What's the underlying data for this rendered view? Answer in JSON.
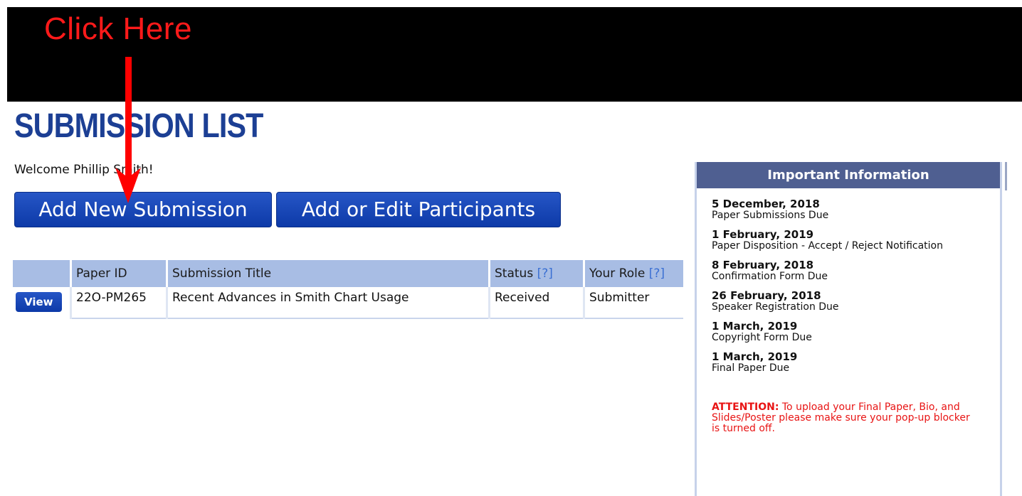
{
  "annotation": {
    "callout": "Click Here"
  },
  "page": {
    "title": "SUBMISSION LIST",
    "welcome": "Welcome Phillip Smith!"
  },
  "actions": {
    "add_submission": "Add New Submission",
    "edit_participants": "Add or Edit Participants"
  },
  "table": {
    "columns": {
      "paper_id": "Paper ID",
      "title": "Submission Title",
      "status": "Status",
      "role": "Your Role",
      "help": "[?]"
    },
    "rows": [
      {
        "action": "View",
        "paper_id": "22O-PM265",
        "title": "Recent Advances in Smith Chart Usage",
        "status": "Received",
        "role": "Submitter"
      }
    ]
  },
  "info": {
    "header": "Important Information",
    "items": [
      {
        "date": "5 December, 2018",
        "desc": "Paper Submissions Due"
      },
      {
        "date": "1 February, 2019",
        "desc": "Paper Disposition - Accept / Reject Notification"
      },
      {
        "date": "8 February, 2018",
        "desc": "Confirmation Form Due"
      },
      {
        "date": "26 February, 2018",
        "desc": "Speaker Registration Due"
      },
      {
        "date": "1 March, 2019",
        "desc": "Copyright Form Due"
      },
      {
        "date": "1 March, 2019",
        "desc": "Final Paper Due"
      }
    ],
    "attention_label": "ATTENTION:",
    "attention_text": " To upload your Final Paper, Bio, and Slides/Poster please make sure your pop-up blocker is turned off."
  },
  "colors": {
    "title": "#1c3f94",
    "button": "#0d3aa8",
    "header_band": "#000000",
    "annotation": "#ff1a1a",
    "panel_header": "#4f5f91",
    "table_header": "#a8bde4",
    "attention": "#e81414"
  }
}
